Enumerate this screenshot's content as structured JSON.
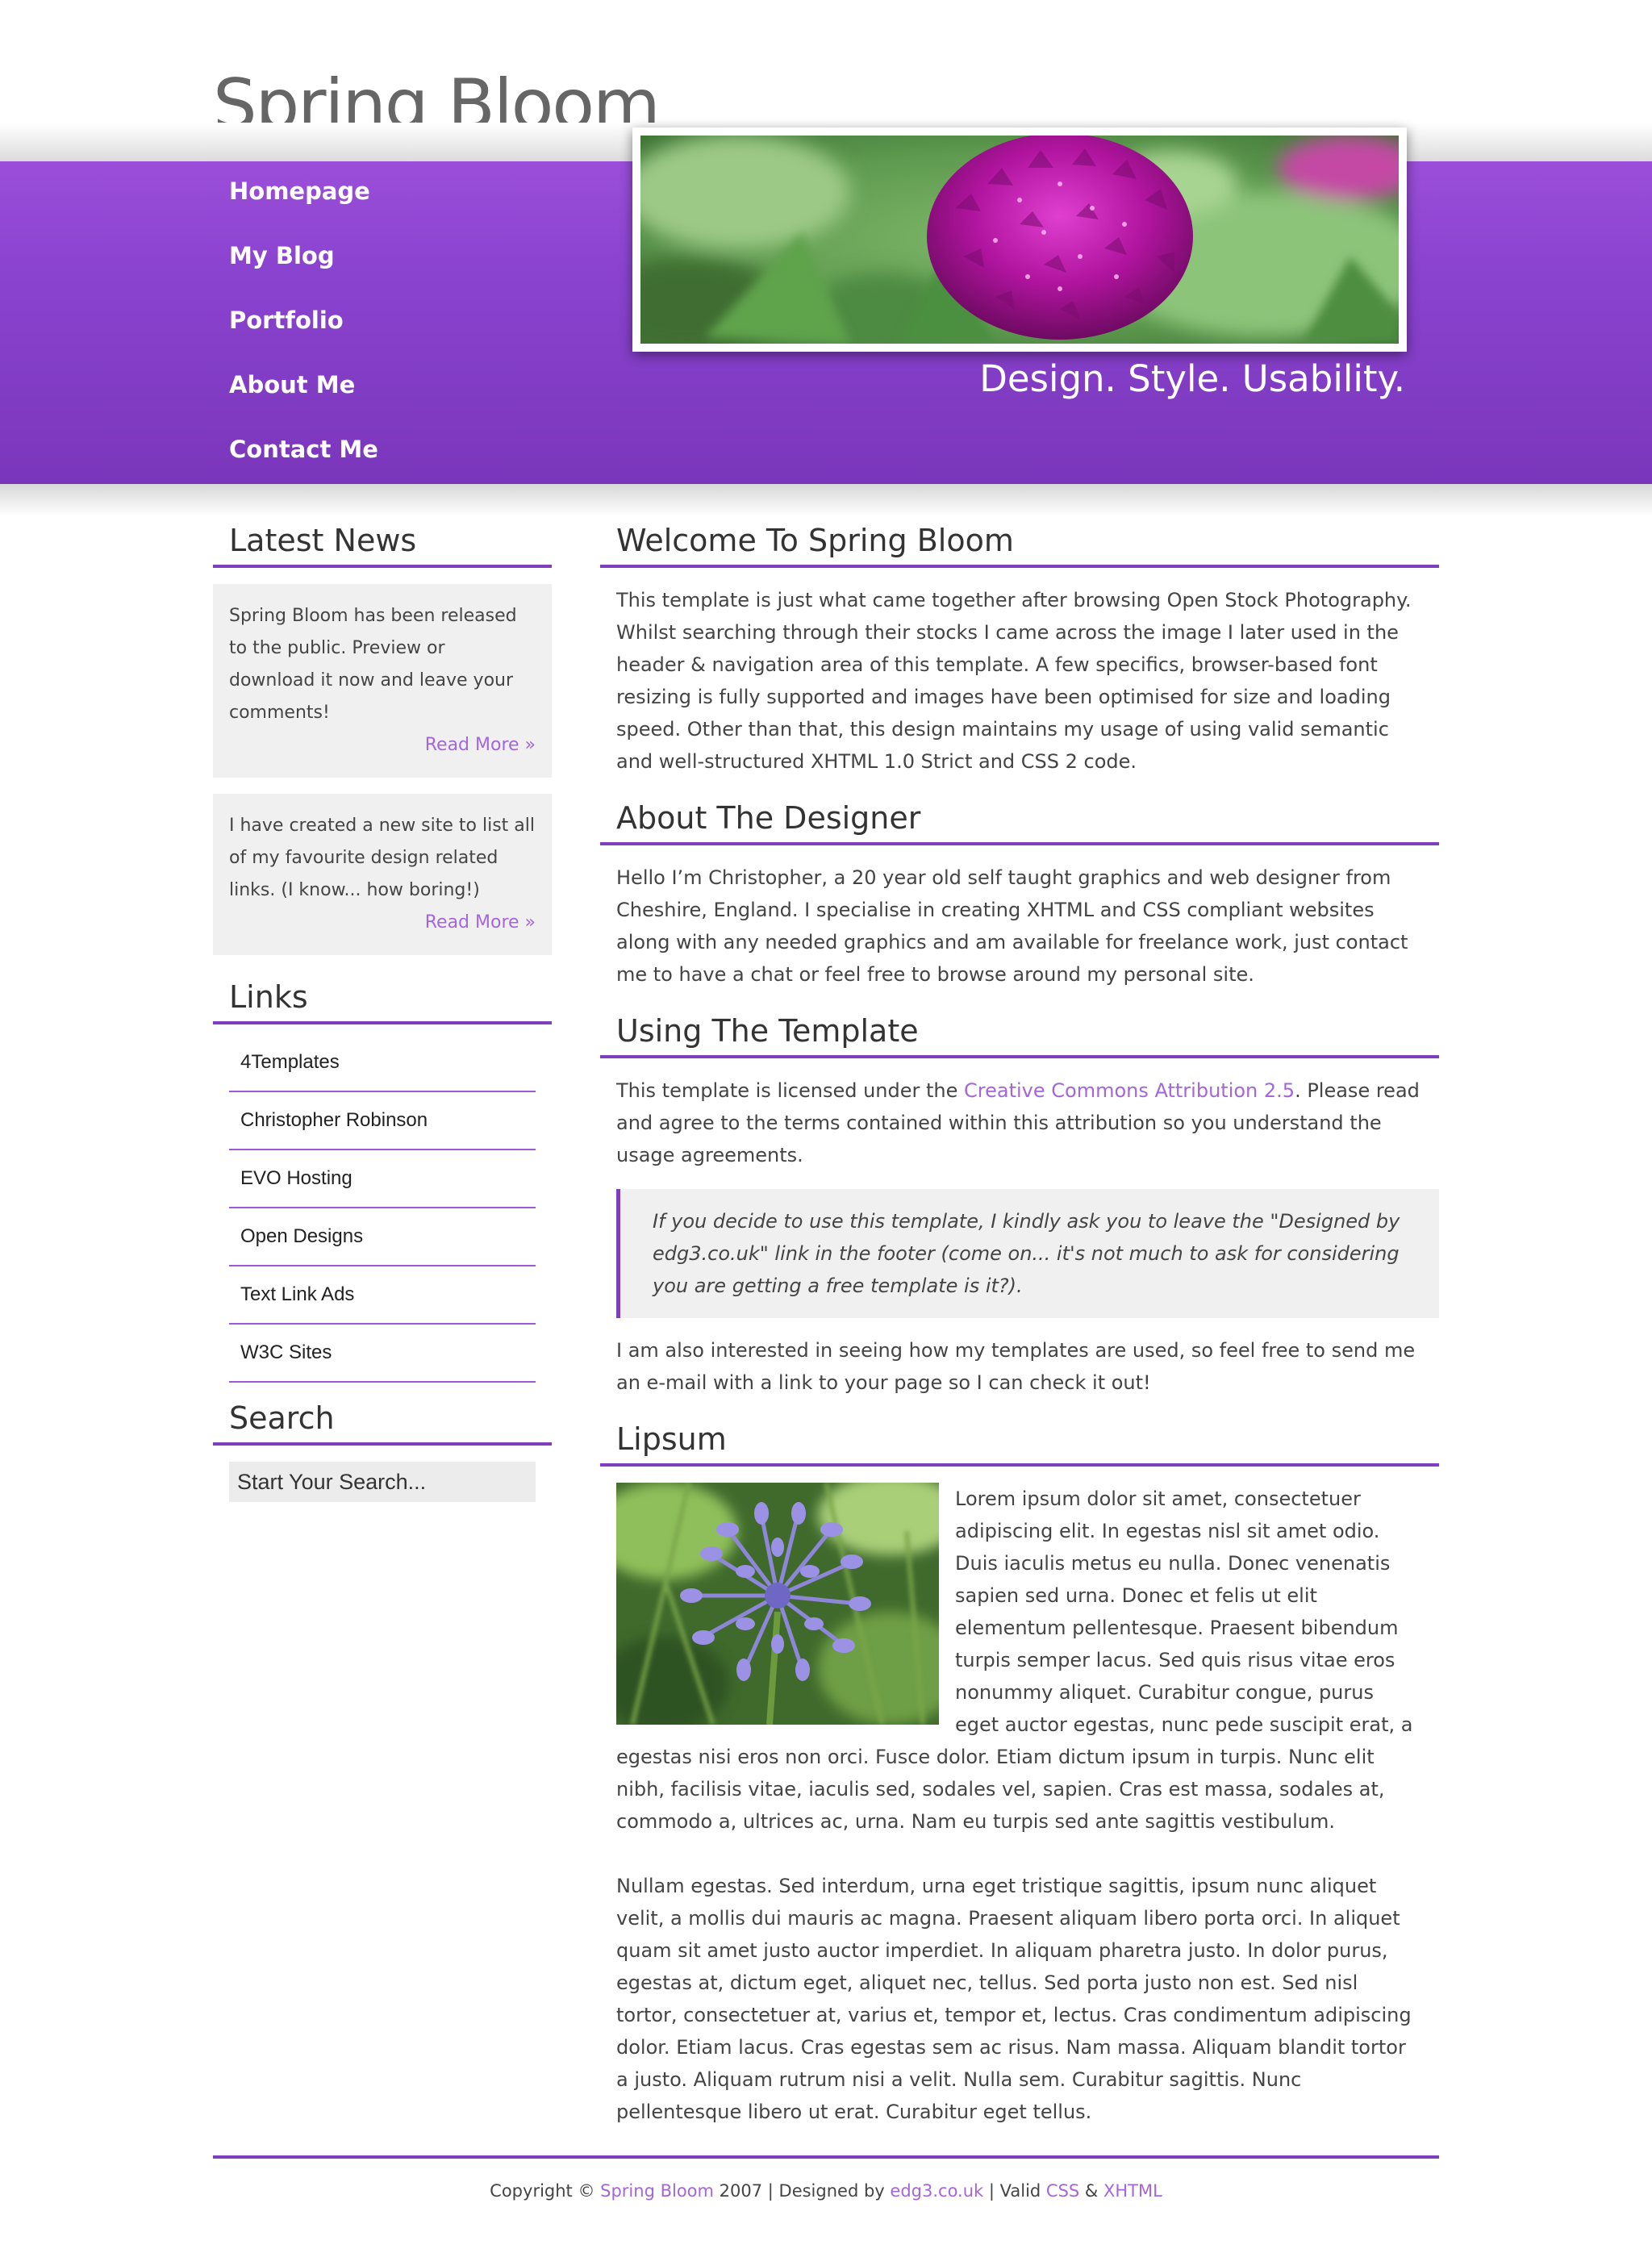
{
  "header": {
    "site_title": "Spring Bloom",
    "tagline": "Design. Style. Usability."
  },
  "nav": {
    "items": [
      {
        "label": "Homepage"
      },
      {
        "label": "My Blog"
      },
      {
        "label": "Portfolio"
      },
      {
        "label": "About Me"
      },
      {
        "label": "Contact Me"
      }
    ]
  },
  "sidebar": {
    "news_heading": "Latest News",
    "news": [
      {
        "text": "Spring Bloom has been released to the public. Preview or download it now and leave your comments!",
        "read_more": "Read More »"
      },
      {
        "text": "I have created a new site to list all of my favourite design related links. (I know... how boring!)",
        "read_more": "Read More »"
      }
    ],
    "links_heading": "Links",
    "links": [
      {
        "label": "4Templates"
      },
      {
        "label": "Christopher Robinson"
      },
      {
        "label": "EVO Hosting"
      },
      {
        "label": "Open Designs"
      },
      {
        "label": "Text Link Ads"
      },
      {
        "label": "W3C Sites"
      }
    ],
    "search_heading": "Search",
    "search_placeholder": "Start Your Search..."
  },
  "content": {
    "welcome_heading": "Welcome To Spring Bloom",
    "welcome_text": "This template is just what came together after browsing Open Stock Photography. Whilst searching through their stocks I came across the image I later used in the header & navigation area of this template. A few specifics, browser-based font resizing is fully supported and images have been optimised for size and loading speed. Other than that, this design maintains my usage of using valid semantic and well-structured XHTML 1.0 Strict and CSS 2 code.",
    "about_heading": "About The Designer",
    "about_text": "Hello I’m Christopher, a 20 year old self taught graphics and web designer from Cheshire, England. I specialise in creating XHTML and CSS compliant websites along with any needed graphics and am available for freelance work, just contact me to have a chat or feel free to browse around my personal site.",
    "using_heading": "Using The Template",
    "license_before": "This template is licensed under the ",
    "license_link": "Creative Commons Attribution 2.5",
    "license_after": ". Please read and agree to the terms contained within this attribution so you understand the usage agreements.",
    "quote": "If you decide to use this template, I kindly ask you to leave the \"Designed by edg3.co.uk\" link in the footer (come on... it's not much to ask for considering you are getting a free template is it?).",
    "interest_text": "I am also interested in seeing how my templates are used, so feel free to send me an e-mail with a link to your page so I can check it out!",
    "lipsum_heading": "Lipsum",
    "lipsum_text_1": "Lorem ipsum dolor sit amet, consectetuer adipiscing elit. In egestas nisl sit amet odio. Duis iaculis metus eu nulla. Donec venenatis sapien sed urna. Donec et felis ut elit elementum pellentesque. Praesent bibendum turpis semper lacus. Sed quis risus vitae eros nonummy aliquet. Curabitur congue, purus eget auctor egestas, nunc pede suscipit erat, a egestas nisi eros non orci. Fusce dolor. Etiam dictum ipsum in turpis. Nunc elit nibh, facilisis vitae, iaculis sed, sodales vel, sapien. Cras est massa, sodales at, commodo a, ultrices ac, urna. Nam eu turpis sed ante sagittis vestibulum.",
    "lipsum_text_2": "Nullam egestas. Sed interdum, urna eget tristique sagittis, ipsum nunc aliquet velit, a mollis dui mauris ac magna. Praesent aliquam libero porta orci. In aliquet quam sit amet justo auctor imperdiet. In aliquam pharetra justo. In dolor purus, egestas at, dictum eget, aliquet nec, tellus. Sed porta justo non est. Sed nisl tortor, consectetuer at, varius et, tempor et, lectus. Cras condimentum adipiscing dolor. Etiam lacus. Cras egestas sem ac risus. Nam massa. Aliquam blandit tortor a justo. Aliquam rutrum nisi a velit. Nulla sem. Curabitur sagittis. Nunc pellentesque libero ut erat. Curabitur eget tellus."
  },
  "footer": {
    "copyright": "Copyright © ",
    "site_link": "Spring Bloom",
    "year_text": " 2007 | Designed by ",
    "designer_link": "edg3.co.uk",
    "valid_text": " | Valid ",
    "css_link": "CSS",
    "amp": " & ",
    "xhtml_link": "XHTML"
  },
  "colors": {
    "accent": "#7e3fbf",
    "header_purple": "#8a43cf",
    "link": "#a366db",
    "box_grey": "#f0f0f0"
  }
}
